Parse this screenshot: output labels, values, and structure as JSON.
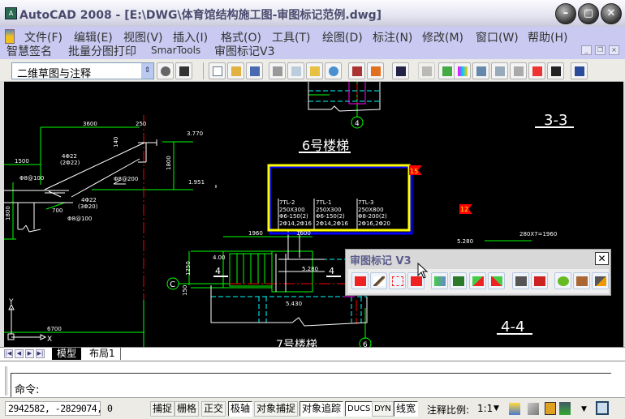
{
  "window": {
    "title": "AutoCAD 2008 - [E:\\DWG\\体育馆结构施工图-审图标记范例.dwg]",
    "app_icon": "A"
  },
  "window_buttons": {
    "minimize": "–",
    "restore": "▢",
    "close": "✕"
  },
  "menu": {
    "row1": [
      "文件(F)",
      "编辑(E)",
      "视图(V)",
      "插入(I)",
      "格式(O)",
      "工具(T)",
      "绘图(D)",
      "标注(N)",
      "修改(M)",
      "窗口(W)",
      "帮助(H)"
    ],
    "row2": [
      "智慧签名",
      "批量分图打印",
      "SmarTools",
      "审图标记V3"
    ],
    "mdi_buttons": [
      "_",
      "❐",
      "×"
    ]
  },
  "toolbar": {
    "workspace": "二维草图与注释",
    "workspace_arrow": "⇕"
  },
  "drawing": {
    "dims": {
      "d3600": "3600",
      "d250": "250",
      "d1500": "1500",
      "d1800a": "1800",
      "d1800b": "1800",
      "d140": "140",
      "d700": "700",
      "d6700": "6700",
      "d1960": "1960",
      "d1600": "1600",
      "d1250": "1250",
      "d150": "150",
      "d280x7": "280X7=1960"
    },
    "levels": {
      "l3770": "3.770",
      "l1951": "1.951",
      "l400": "4.00",
      "l5280a": "5.280",
      "l5280b": "5.280",
      "l5430": "5.430"
    },
    "rebar": {
      "r1": "4Φ22",
      "r1b": "(2Φ22)",
      "r2": "Φ8@100",
      "r3": "Φ8@200",
      "r4": "4Φ22",
      "r4b": "(3Φ20)",
      "r5": "Φ8@100"
    },
    "titles": {
      "stair6": "6号楼梯",
      "sec33": "3-3",
      "sec44": "4-4",
      "stair7": "7号楼梯"
    },
    "axes": {
      "c": "C",
      "four": "4",
      "six": "6",
      "x": "X",
      "y": "Y"
    },
    "section_marks": {
      "s4a": "4",
      "s4b": "4"
    },
    "beam_table": [
      [
        "7TL-2",
        "250X300",
        "Φ6-150(2)",
        "2Φ14,2Φ16"
      ],
      [
        "7TL-1",
        "250X300",
        "Φ6-150(2)",
        "2Φ14,2Φ16"
      ],
      [
        "7TL-3",
        "250X800",
        "Φ8-200(2)",
        "2Φ16,2Φ20"
      ]
    ],
    "flags": {
      "f15": "15",
      "f12": "12"
    },
    "colors": {
      "markup_box": "#ffff00",
      "markup_shadow": "#0000ff",
      "flag": "#ff0000",
      "dim": "#00ff00",
      "center": "#ff0000",
      "hidden": "#00ffff"
    }
  },
  "palette": {
    "title": "审图标记 V3",
    "close": "✕",
    "buttons": [
      "add-mark",
      "pen",
      "delete-mark",
      "edit-mark",
      "export",
      "excel",
      "import-mark",
      "import-mark-2",
      "autocad-a",
      "autocad-red",
      "ie",
      "help-book",
      "tools"
    ]
  },
  "tabs": {
    "model": "模型",
    "layout1": "布局1",
    "nav": [
      "|◀",
      "◀",
      "▶",
      "▶|"
    ]
  },
  "command": {
    "prompt": "命令:"
  },
  "status": {
    "coords": "2942582, -2829074, 0",
    "buttons": [
      {
        "label": "捕捉",
        "on": false
      },
      {
        "label": "栅格",
        "on": false
      },
      {
        "label": "正交",
        "on": false
      },
      {
        "label": "极轴",
        "on": true
      },
      {
        "label": "对象捕捉",
        "on": false
      },
      {
        "label": "对象追踪",
        "on": true
      },
      {
        "label": "DUCS",
        "on": true
      },
      {
        "label": "DYN",
        "on": false
      },
      {
        "label": "线宽",
        "on": true
      }
    ],
    "scale_label": "注释比例:",
    "scale_value": "1:1",
    "scale_arrow": "▼"
  }
}
